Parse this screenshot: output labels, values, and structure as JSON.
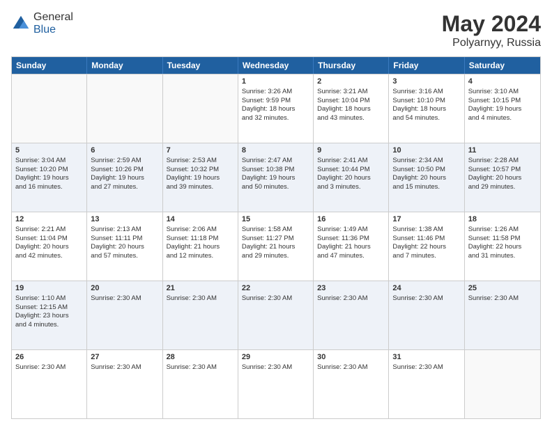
{
  "header": {
    "logo_general": "General",
    "logo_blue": "Blue",
    "month_title": "May 2024",
    "location": "Polyarnyy, Russia"
  },
  "days_of_week": [
    "Sunday",
    "Monday",
    "Tuesday",
    "Wednesday",
    "Thursday",
    "Friday",
    "Saturday"
  ],
  "weeks": [
    [
      {
        "day": "",
        "empty": true
      },
      {
        "day": "",
        "empty": true
      },
      {
        "day": "",
        "empty": true
      },
      {
        "day": "1",
        "lines": [
          "Sunrise: 3:26 AM",
          "Sunset: 9:59 PM",
          "Daylight: 18 hours",
          "and 32 minutes."
        ]
      },
      {
        "day": "2",
        "lines": [
          "Sunrise: 3:21 AM",
          "Sunset: 10:04 PM",
          "Daylight: 18 hours",
          "and 43 minutes."
        ]
      },
      {
        "day": "3",
        "lines": [
          "Sunrise: 3:16 AM",
          "Sunset: 10:10 PM",
          "Daylight: 18 hours",
          "and 54 minutes."
        ]
      },
      {
        "day": "4",
        "lines": [
          "Sunrise: 3:10 AM",
          "Sunset: 10:15 PM",
          "Daylight: 19 hours",
          "and 4 minutes."
        ]
      }
    ],
    [
      {
        "day": "5",
        "lines": [
          "Sunrise: 3:04 AM",
          "Sunset: 10:20 PM",
          "Daylight: 19 hours",
          "and 16 minutes."
        ]
      },
      {
        "day": "6",
        "lines": [
          "Sunrise: 2:59 AM",
          "Sunset: 10:26 PM",
          "Daylight: 19 hours",
          "and 27 minutes."
        ]
      },
      {
        "day": "7",
        "lines": [
          "Sunrise: 2:53 AM",
          "Sunset: 10:32 PM",
          "Daylight: 19 hours",
          "and 39 minutes."
        ]
      },
      {
        "day": "8",
        "lines": [
          "Sunrise: 2:47 AM",
          "Sunset: 10:38 PM",
          "Daylight: 19 hours",
          "and 50 minutes."
        ]
      },
      {
        "day": "9",
        "lines": [
          "Sunrise: 2:41 AM",
          "Sunset: 10:44 PM",
          "Daylight: 20 hours",
          "and 3 minutes."
        ]
      },
      {
        "day": "10",
        "lines": [
          "Sunrise: 2:34 AM",
          "Sunset: 10:50 PM",
          "Daylight: 20 hours",
          "and 15 minutes."
        ]
      },
      {
        "day": "11",
        "lines": [
          "Sunrise: 2:28 AM",
          "Sunset: 10:57 PM",
          "Daylight: 20 hours",
          "and 29 minutes."
        ]
      }
    ],
    [
      {
        "day": "12",
        "lines": [
          "Sunrise: 2:21 AM",
          "Sunset: 11:04 PM",
          "Daylight: 20 hours",
          "and 42 minutes."
        ]
      },
      {
        "day": "13",
        "lines": [
          "Sunrise: 2:13 AM",
          "Sunset: 11:11 PM",
          "Daylight: 20 hours",
          "and 57 minutes."
        ]
      },
      {
        "day": "14",
        "lines": [
          "Sunrise: 2:06 AM",
          "Sunset: 11:18 PM",
          "Daylight: 21 hours",
          "and 12 minutes."
        ]
      },
      {
        "day": "15",
        "lines": [
          "Sunrise: 1:58 AM",
          "Sunset: 11:27 PM",
          "Daylight: 21 hours",
          "and 29 minutes."
        ]
      },
      {
        "day": "16",
        "lines": [
          "Sunrise: 1:49 AM",
          "Sunset: 11:36 PM",
          "Daylight: 21 hours",
          "and 47 minutes."
        ]
      },
      {
        "day": "17",
        "lines": [
          "Sunrise: 1:38 AM",
          "Sunset: 11:46 PM",
          "Daylight: 22 hours",
          "and 7 minutes."
        ]
      },
      {
        "day": "18",
        "lines": [
          "Sunrise: 1:26 AM",
          "Sunset: 11:58 PM",
          "Daylight: 22 hours",
          "and 31 minutes."
        ]
      }
    ],
    [
      {
        "day": "19",
        "lines": [
          "Sunrise: 1:10 AM",
          "Sunset: 12:15 AM",
          "Daylight: 23 hours",
          "and 4 minutes."
        ]
      },
      {
        "day": "20",
        "lines": [
          "Sunrise: 2:30 AM"
        ]
      },
      {
        "day": "21",
        "lines": [
          "Sunrise: 2:30 AM"
        ]
      },
      {
        "day": "22",
        "lines": [
          "Sunrise: 2:30 AM"
        ]
      },
      {
        "day": "23",
        "lines": [
          "Sunrise: 2:30 AM"
        ]
      },
      {
        "day": "24",
        "lines": [
          "Sunrise: 2:30 AM"
        ]
      },
      {
        "day": "25",
        "lines": [
          "Sunrise: 2:30 AM"
        ]
      }
    ],
    [
      {
        "day": "26",
        "lines": [
          "Sunrise: 2:30 AM"
        ]
      },
      {
        "day": "27",
        "lines": [
          "Sunrise: 2:30 AM"
        ]
      },
      {
        "day": "28",
        "lines": [
          "Sunrise: 2:30 AM"
        ]
      },
      {
        "day": "29",
        "lines": [
          "Sunrise: 2:30 AM"
        ]
      },
      {
        "day": "30",
        "lines": [
          "Sunrise: 2:30 AM"
        ]
      },
      {
        "day": "31",
        "lines": [
          "Sunrise: 2:30 AM"
        ]
      },
      {
        "day": "",
        "empty": true
      }
    ]
  ]
}
